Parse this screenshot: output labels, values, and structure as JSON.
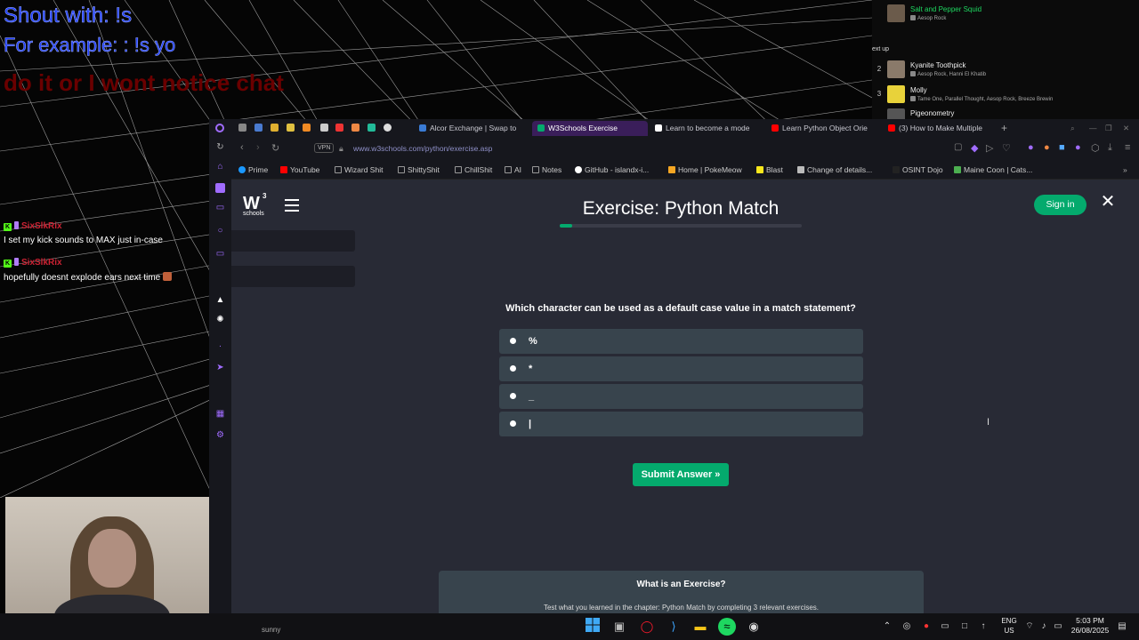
{
  "overlay": {
    "shout_line1": "Shout with: !s",
    "shout_line2": "For example: : !s yo",
    "shout_line3": "do it or I wont notice chat"
  },
  "queue": {
    "now_playing": {
      "title": "Salt and Pepper Squid",
      "artist": "Aesop Rock",
      "art_color": "#6b5b4b"
    },
    "next_up_label": "ext up",
    "items": [
      {
        "num": "2",
        "title": "Kyanite Toothpick",
        "artist": "Aesop Rock, Hanni El Khatib",
        "art_color": "#8a7a6a"
      },
      {
        "num": "3",
        "title": "Molly",
        "artist": "Tame One, Parallel Thought, Aesop Rock, Breeze Brewin",
        "art_color": "#e8d23a"
      },
      {
        "num": "",
        "title": "Pigeonometry",
        "artist": "",
        "art_color": "#555555"
      }
    ]
  },
  "chat": [
    {
      "user": "SixSlkRix",
      "message": "I set my kick sounds to MAX just in-case"
    },
    {
      "user": "SixSlkRix",
      "message": "hopefully doesnt explode ears next time"
    }
  ],
  "browser": {
    "tabs": [
      {
        "label": "Alcor Exchange | Swap to",
        "icon_color": "#3a7bd5"
      },
      {
        "label": "W3Schools Exercise",
        "icon_color": "#04aa6d",
        "active": true
      },
      {
        "label": "Learn to become a mode",
        "icon_color": "#ffffff"
      },
      {
        "label": "Learn Python Object Orie",
        "icon_color": "#ff0000"
      },
      {
        "label": "(3) How to Make Multiple",
        "icon_color": "#ff0000"
      }
    ],
    "new_tab_label": "+",
    "vpn_label": "VPN",
    "url": "www.w3schools.com/python/exercise.asp",
    "bookmarks": [
      {
        "label": "Prime",
        "icon_color": "#1a98ff"
      },
      {
        "label": "YouTube",
        "icon_color": "#ff0000"
      },
      {
        "label": "Wizard Shit",
        "icon_color": "#999999"
      },
      {
        "label": "ShittyShit",
        "icon_color": "#999999"
      },
      {
        "label": "ChillShit",
        "icon_color": "#999999"
      },
      {
        "label": "AI",
        "icon_color": "#999999"
      },
      {
        "label": "Notes",
        "icon_color": "#999999"
      },
      {
        "label": "GitHub - islandx-i...",
        "icon_color": "#ffffff"
      },
      {
        "label": "Home | PokeMeow",
        "icon_color": "#f5a623"
      },
      {
        "label": "Blast",
        "icon_color": "#f8e71c"
      },
      {
        "label": "Change of details...",
        "icon_color": "#bbbbbb"
      },
      {
        "label": "OSINT Dojo",
        "icon_color": "#222222"
      },
      {
        "label": "Maine Coon | Cats...",
        "icon_color": "#4caf50"
      }
    ]
  },
  "page": {
    "logo_big": "W",
    "logo_sup": "3",
    "logo_small": "schools",
    "title": "Exercise: Python Match",
    "progress_fraction": 0.05,
    "sign_in_label": "Sign in",
    "close_label": "✕",
    "question": "Which character can be used as a default case value in a match statement?",
    "options": [
      "%",
      "*",
      "_",
      "|"
    ],
    "submit_label": "Submit Answer »",
    "card_title": "What is an Exercise?",
    "card_sub": "Test what you learned in the chapter: Python Match by completing 3 relevant exercises."
  },
  "taskbar": {
    "lang_line1": "ENG",
    "lang_line2": "US",
    "time": "5:03 PM",
    "date": "26/08/2025",
    "cam_caption": "sunny"
  },
  "colors": {
    "w3_green": "#04aa6d",
    "page_bg": "#282a35",
    "option_bg": "#38444d",
    "opera_purple": "#a06cff"
  }
}
